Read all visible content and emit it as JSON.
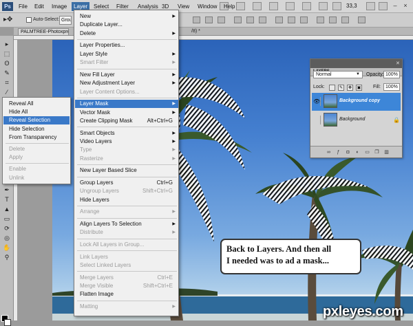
{
  "menubar": {
    "items": [
      "File",
      "Edit",
      "Image",
      "Layer",
      "Select",
      "Filter",
      "Analysis",
      "3D",
      "View",
      "Window",
      "Help"
    ],
    "active": "Layer",
    "zoom": "33,3"
  },
  "options_bar": {
    "auto_select_label": "Auto-Select:",
    "auto_select_value": "Group"
  },
  "document": {
    "tab_title": "PALMTREE-Photoxpress",
    "tab_suffix": "/8) *"
  },
  "layer_menu": {
    "items": [
      {
        "label": "New",
        "shortcut": "",
        "submenu": true,
        "disabled": false,
        "highlight": false
      },
      {
        "label": "Duplicate Layer...",
        "shortcut": "",
        "submenu": false,
        "disabled": false,
        "highlight": false
      },
      {
        "label": "Delete",
        "shortcut": "",
        "submenu": true,
        "disabled": false,
        "highlight": false
      },
      {
        "label": "Layer Properties...",
        "shortcut": "",
        "submenu": false,
        "disabled": false,
        "highlight": false
      },
      {
        "label": "Layer Style",
        "shortcut": "",
        "submenu": true,
        "disabled": false,
        "highlight": false
      },
      {
        "label": "Smart Filter",
        "shortcut": "",
        "submenu": true,
        "disabled": true,
        "highlight": false
      },
      {
        "label": "New Fill Layer",
        "shortcut": "",
        "submenu": true,
        "disabled": false,
        "highlight": false
      },
      {
        "label": "New Adjustment Layer",
        "shortcut": "",
        "submenu": true,
        "disabled": false,
        "highlight": false
      },
      {
        "label": "Layer Content Options...",
        "shortcut": "",
        "submenu": false,
        "disabled": true,
        "highlight": false
      },
      {
        "label": "Layer Mask",
        "shortcut": "",
        "submenu": true,
        "disabled": false,
        "highlight": true
      },
      {
        "label": "Vector Mask",
        "shortcut": "",
        "submenu": true,
        "disabled": false,
        "highlight": false
      },
      {
        "label": "Create Clipping Mask",
        "shortcut": "Alt+Ctrl+G",
        "submenu": false,
        "disabled": false,
        "highlight": false
      },
      {
        "label": "Smart Objects",
        "shortcut": "",
        "submenu": true,
        "disabled": false,
        "highlight": false
      },
      {
        "label": "Video Layers",
        "shortcut": "",
        "submenu": true,
        "disabled": false,
        "highlight": false
      },
      {
        "label": "Type",
        "shortcut": "",
        "submenu": true,
        "disabled": true,
        "highlight": false
      },
      {
        "label": "Rasterize",
        "shortcut": "",
        "submenu": true,
        "disabled": true,
        "highlight": false
      },
      {
        "label": "New Layer Based Slice",
        "shortcut": "",
        "submenu": false,
        "disabled": false,
        "highlight": false
      },
      {
        "label": "Group Layers",
        "shortcut": "Ctrl+G",
        "submenu": false,
        "disabled": false,
        "highlight": false
      },
      {
        "label": "Ungroup Layers",
        "shortcut": "Shift+Ctrl+G",
        "submenu": false,
        "disabled": true,
        "highlight": false
      },
      {
        "label": "Hide Layers",
        "shortcut": "",
        "submenu": false,
        "disabled": false,
        "highlight": false
      },
      {
        "label": "Arrange",
        "shortcut": "",
        "submenu": true,
        "disabled": true,
        "highlight": false
      },
      {
        "label": "Align Layers To Selection",
        "shortcut": "",
        "submenu": true,
        "disabled": false,
        "highlight": false
      },
      {
        "label": "Distribute",
        "shortcut": "",
        "submenu": true,
        "disabled": true,
        "highlight": false
      },
      {
        "label": "Lock All Layers in Group...",
        "shortcut": "",
        "submenu": false,
        "disabled": true,
        "highlight": false
      },
      {
        "label": "Link Layers",
        "shortcut": "",
        "submenu": false,
        "disabled": true,
        "highlight": false
      },
      {
        "label": "Select Linked Layers",
        "shortcut": "",
        "submenu": false,
        "disabled": true,
        "highlight": false
      },
      {
        "label": "Merge Layers",
        "shortcut": "Ctrl+E",
        "submenu": false,
        "disabled": true,
        "highlight": false
      },
      {
        "label": "Merge Visible",
        "shortcut": "Shift+Ctrl+E",
        "submenu": false,
        "disabled": true,
        "highlight": false
      },
      {
        "label": "Flatten Image",
        "shortcut": "",
        "submenu": false,
        "disabled": false,
        "highlight": false
      },
      {
        "label": "Matting",
        "shortcut": "",
        "submenu": true,
        "disabled": true,
        "highlight": false
      }
    ]
  },
  "layer_mask_submenu": {
    "items": [
      {
        "label": "Reveal All",
        "disabled": false,
        "highlight": false
      },
      {
        "label": "Hide All",
        "disabled": false,
        "highlight": false
      },
      {
        "label": "Reveal Selection",
        "disabled": false,
        "highlight": true
      },
      {
        "label": "Hide Selection",
        "disabled": false,
        "highlight": false
      },
      {
        "label": "From Transparency",
        "disabled": false,
        "highlight": false
      },
      {
        "label": "Delete",
        "disabled": true,
        "highlight": false
      },
      {
        "label": "Apply",
        "disabled": true,
        "highlight": false
      },
      {
        "label": "Enable",
        "disabled": true,
        "highlight": false
      },
      {
        "label": "Unlink",
        "disabled": true,
        "highlight": false
      }
    ]
  },
  "layers_panel": {
    "title": "LAYERS",
    "blend_mode": "Normal",
    "opacity_label": "Opacity:",
    "opacity_value": "100%",
    "lock_label": "Lock:",
    "fill_label": "Fill:",
    "fill_value": "100%",
    "layers": [
      {
        "name": "Background copy",
        "selected": true,
        "visible": true,
        "locked": false
      },
      {
        "name": "Background",
        "selected": false,
        "visible": false,
        "locked": true
      }
    ]
  },
  "annotation": {
    "line1": "Back to Layers. And then all",
    "line2": "I needed was to ad a mask..."
  },
  "watermark": "pxleyes.com",
  "colors": {
    "menu_highlight": "#3a79c8",
    "selected_layer": "#3d86d8",
    "sky_top": "#2a62b8",
    "sky_bottom": "#d8e7f2"
  }
}
